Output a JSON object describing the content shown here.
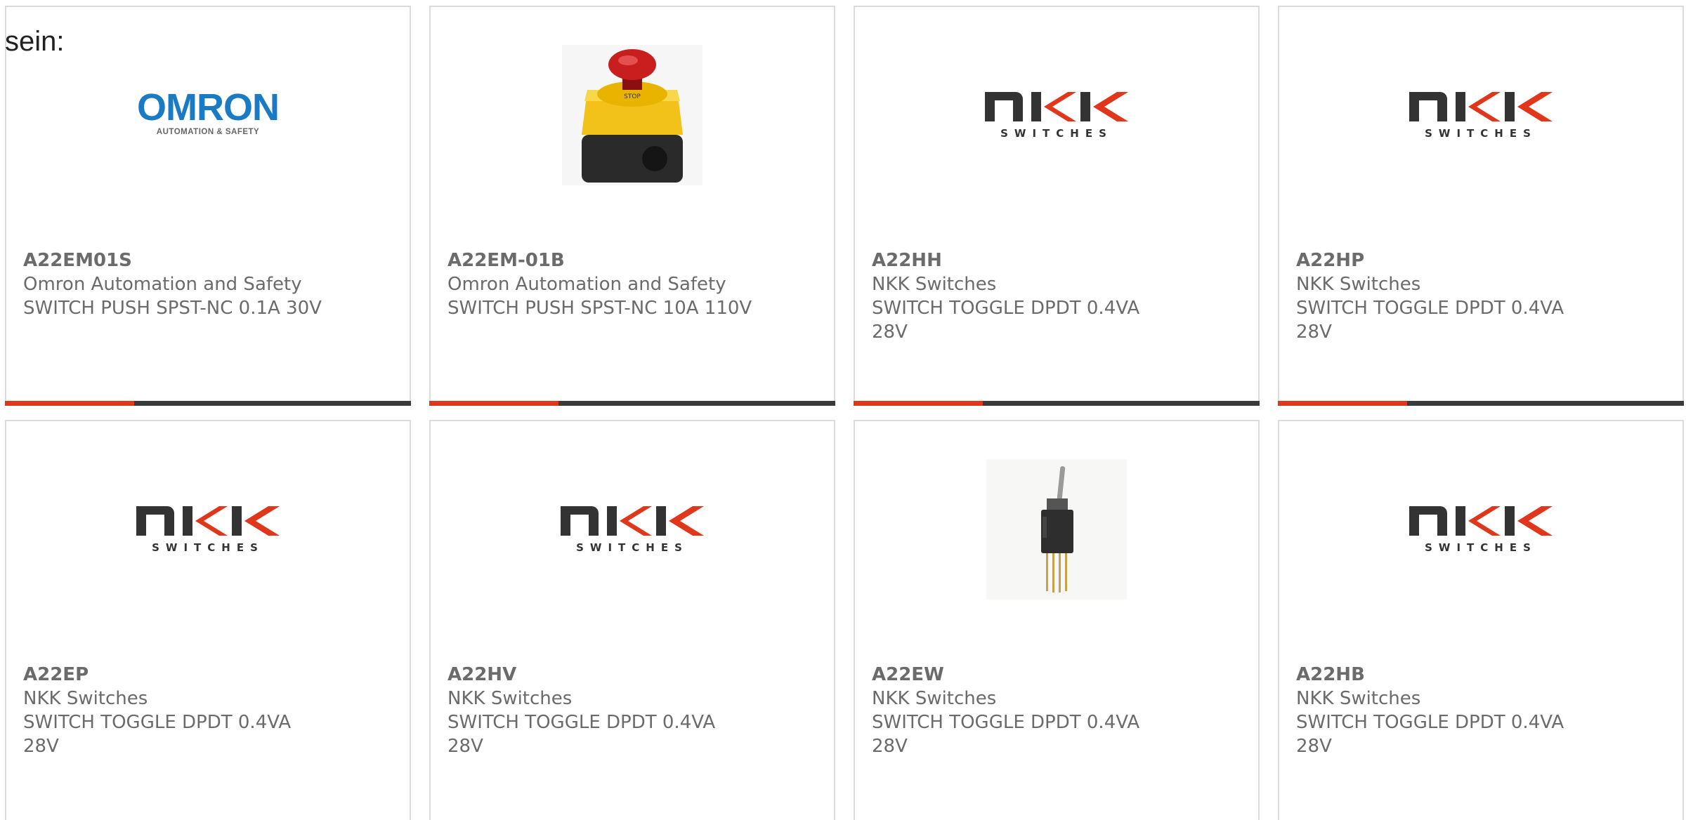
{
  "intro_text": "sein:",
  "accent_color": "#e0361b",
  "bar_color": "#3a3a3a",
  "cards": [
    {
      "part": "A22EM01S",
      "maker": "Omron Automation and Safety",
      "desc": "SWITCH PUSH SPST-NC 0.1A 30V",
      "image": "omron-logo",
      "logo_word": "OMRON",
      "logo_tagline": "AUTOMATION & SAFETY"
    },
    {
      "part": "A22EM-01B",
      "maker": "Omron Automation and Safety",
      "desc": "SWITCH PUSH SPST-NC 10A 110V",
      "image": "emergency-stop-button-photo",
      "photo_label": "STOP"
    },
    {
      "part": "A22HH",
      "maker": "NKK Switches",
      "desc": "SWITCH TOGGLE DPDT 0.4VA 28V",
      "image": "nkk-logo",
      "logo_tagline": "SWITCHES"
    },
    {
      "part": "A22HP",
      "maker": "NKK Switches",
      "desc": "SWITCH TOGGLE DPDT 0.4VA 28V",
      "image": "nkk-logo",
      "logo_tagline": "SWITCHES"
    },
    {
      "part": "A22EP",
      "maker": "NKK Switches",
      "desc": "SWITCH TOGGLE DPDT 0.4VA 28V",
      "image": "nkk-logo",
      "logo_tagline": "SWITCHES"
    },
    {
      "part": "A22HV",
      "maker": "NKK Switches",
      "desc": "SWITCH TOGGLE DPDT 0.4VA 28V",
      "image": "nkk-logo",
      "logo_tagline": "SWITCHES"
    },
    {
      "part": "A22EW",
      "maker": "NKK Switches",
      "desc": "SWITCH TOGGLE DPDT 0.4VA 28V",
      "image": "toggle-switch-photo"
    },
    {
      "part": "A22HB",
      "maker": "NKK Switches",
      "desc": "SWITCH TOGGLE DPDT 0.4VA 28V",
      "image": "nkk-logo",
      "logo_tagline": "SWITCHES"
    }
  ]
}
